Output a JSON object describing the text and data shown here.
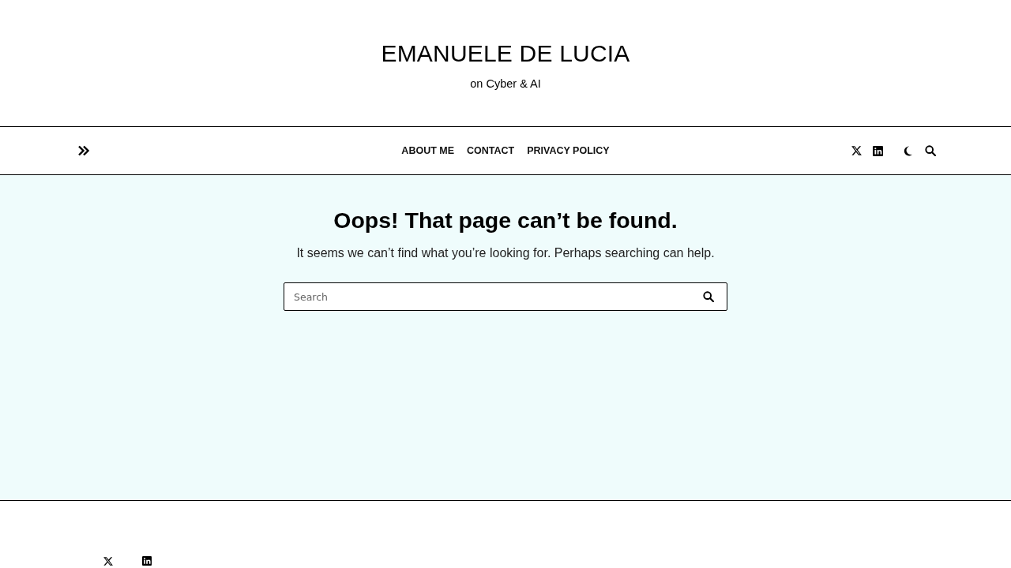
{
  "site": {
    "title": "EMANUELE DE LUCIA",
    "tagline": "on Cyber & AI"
  },
  "nav": {
    "menu_items": [
      {
        "label": "ABOUT ME"
      },
      {
        "label": "CONTACT"
      },
      {
        "label": "PRIVACY POLICY"
      }
    ]
  },
  "main": {
    "heading": "Oops! That page can’t be found.",
    "message": "It seems we can’t find what you’re looking for. Perhaps searching can help.",
    "search": {
      "placeholder": "Search"
    }
  }
}
